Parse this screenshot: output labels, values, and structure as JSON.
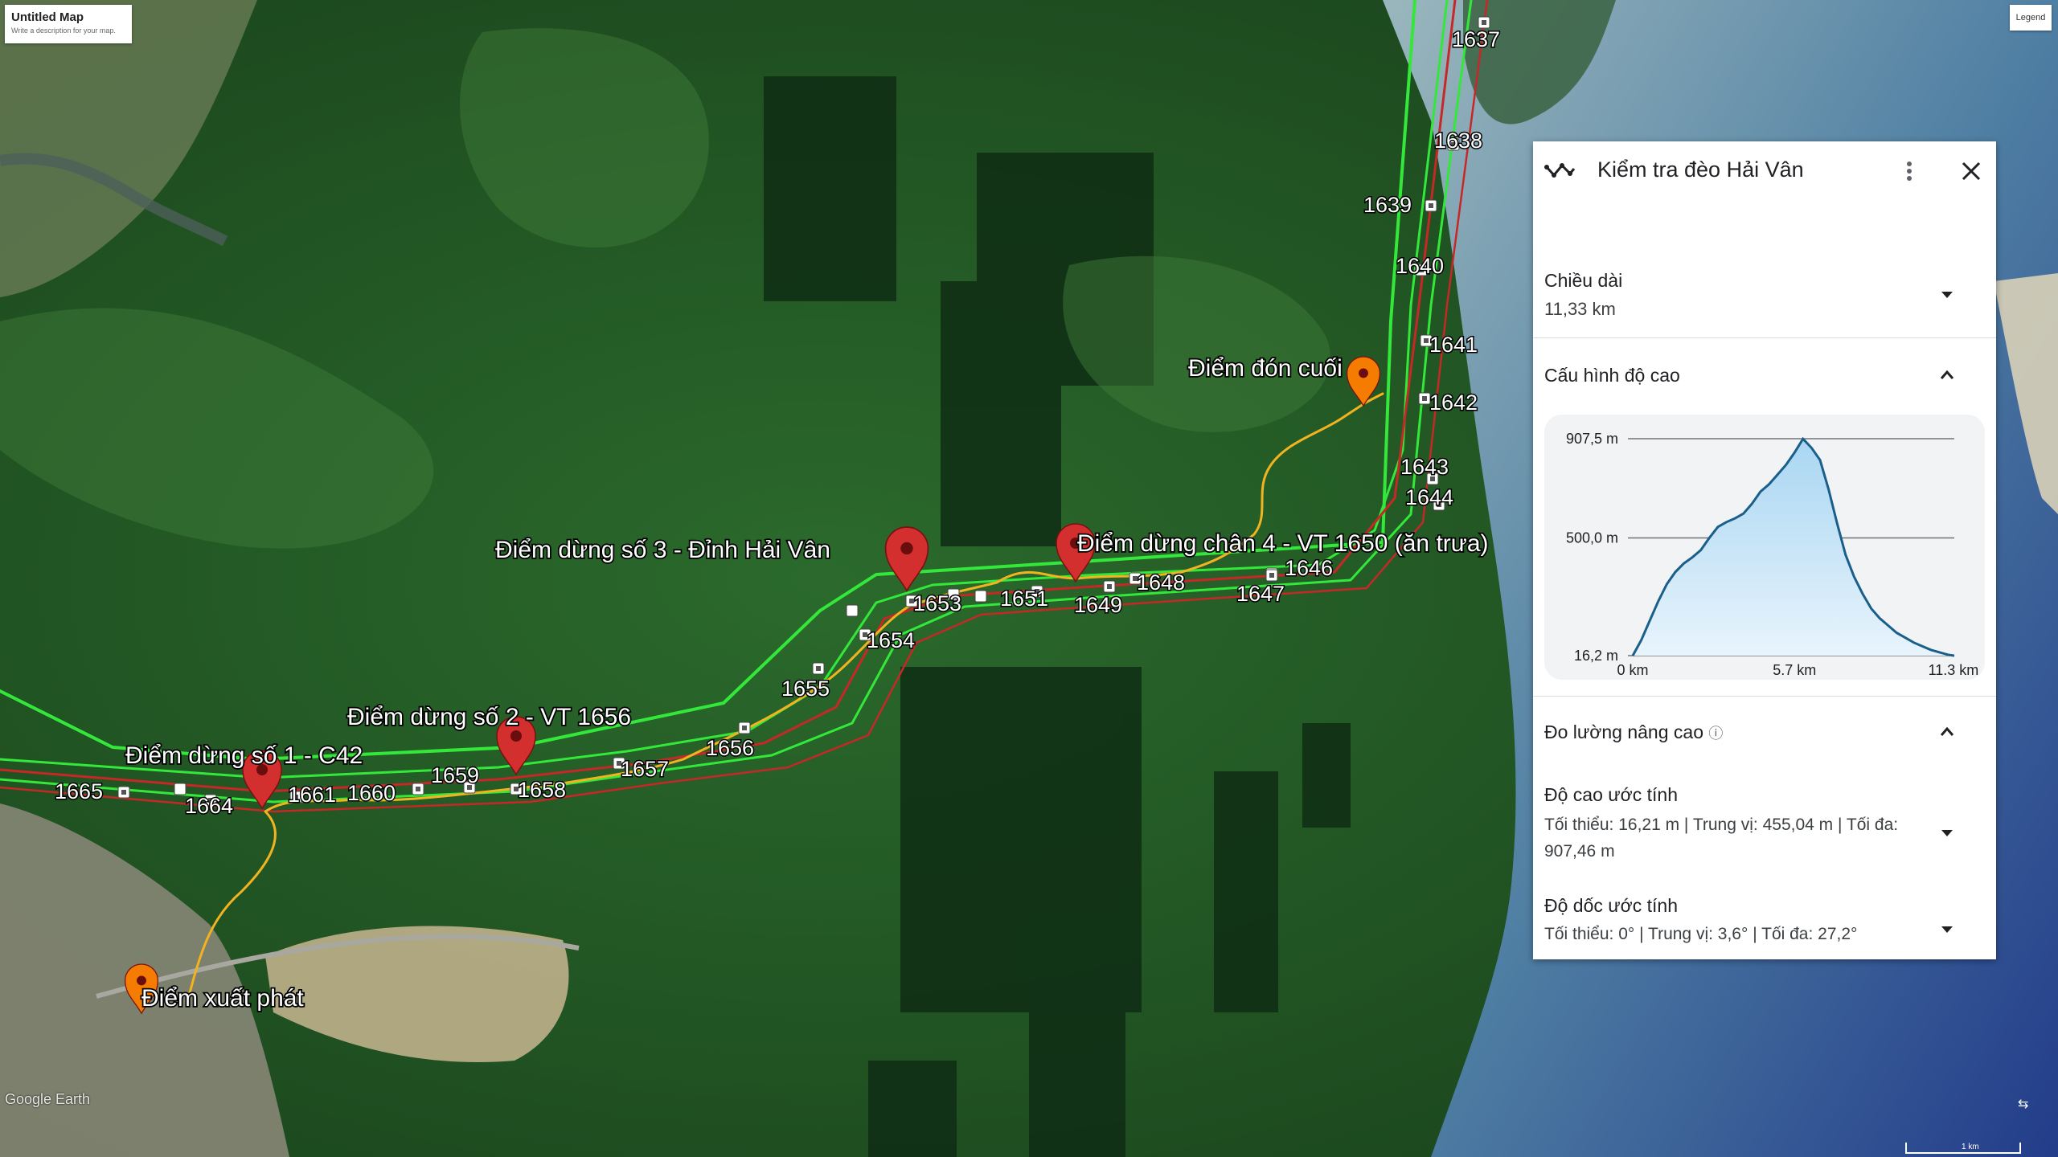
{
  "map": {
    "title": "Untitled Map",
    "description": "Write a description for your map.",
    "legend_label": "Legend",
    "attribution": "Google Earth",
    "scale_label": "1 km",
    "pins": {
      "start": "Điểm xuất phát",
      "stop1": "Điểm dừng số 1 - C42",
      "stop2": "Điểm dừng số 2 - VT 1656",
      "stop3": "Điểm dừng số 3 - Đỉnh Hải Vân",
      "stop4": "Điểm dừng chân 4 - VT 1650 (ăn trưa)",
      "end": "Điểm đón cuối"
    },
    "towers": [
      "1637",
      "1638",
      "1639",
      "1640",
      "1641",
      "1642",
      "1643",
      "1644",
      "1646",
      "1647",
      "1648",
      "1649",
      "1651",
      "1653",
      "1654",
      "1655",
      "1656",
      "1657",
      "1658",
      "1659",
      "1660",
      "1661",
      "1664",
      "1665"
    ],
    "colors": {
      "pin_red": "#d32f2f",
      "pin_orange": "#f57c00",
      "line_green": "#33e83a",
      "line_red": "#c62828",
      "line_yellow": "#f2b320"
    }
  },
  "panel": {
    "title": "Kiểm tra đèo Hải Vân",
    "length_label": "Chiều dài",
    "length_value": "11,33 km",
    "profile_label": "Cấu hình độ cao",
    "advanced_label": "Đo lường nâng cao",
    "elevation_label": "Độ cao ước tính",
    "elevation_value": "Tối thiểu: 16,21 m | Trung vị: 455,04 m | Tối đa: 907,46 m",
    "slope_label": "Độ dốc ước tính",
    "slope_value": "Tối thiểu: 0° | Trung vị: 3,6° | Tối đa: 27,2°"
  },
  "chart_data": {
    "type": "area",
    "x": [
      0,
      0.3,
      0.6,
      0.9,
      1.2,
      1.5,
      1.8,
      2.1,
      2.4,
      2.7,
      3.0,
      3.3,
      3.6,
      3.9,
      4.2,
      4.5,
      4.8,
      5.1,
      5.4,
      5.7,
      6.0,
      6.3,
      6.6,
      6.9,
      7.2,
      7.5,
      7.8,
      8.1,
      8.4,
      8.7,
      9.0,
      9.3,
      9.6,
      9.9,
      10.2,
      10.5,
      10.8,
      11.1,
      11.33
    ],
    "values": [
      16,
      80,
      160,
      240,
      310,
      360,
      395,
      420,
      450,
      500,
      545,
      565,
      580,
      600,
      640,
      690,
      720,
      760,
      800,
      850,
      907,
      870,
      820,
      700,
      560,
      430,
      340,
      270,
      210,
      170,
      140,
      110,
      90,
      70,
      55,
      40,
      30,
      20,
      16
    ],
    "y_ticks": [
      "907,5 m",
      "500,0 m",
      "16,2 m"
    ],
    "x_ticks": [
      "0 km",
      "5.7 km",
      "11.3 km"
    ],
    "ylim": [
      16.2,
      907.5
    ],
    "xlim": [
      0,
      11.33
    ],
    "colors": {
      "line": "#1a5f8a",
      "fill_top": "#a9d6f2",
      "fill_bottom": "#e8f4fc"
    }
  }
}
